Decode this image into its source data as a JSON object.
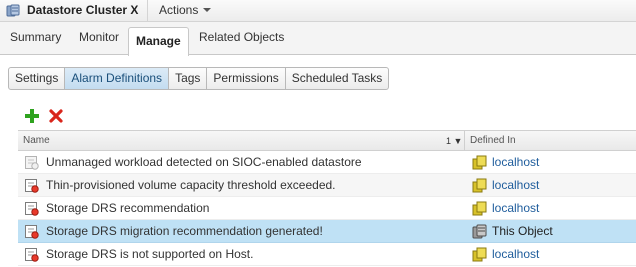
{
  "header": {
    "title": "Datastore Cluster X",
    "actions_label": "Actions"
  },
  "main_tabs": [
    {
      "label": "Summary"
    },
    {
      "label": "Monitor"
    },
    {
      "label": "Manage",
      "active": true
    },
    {
      "label": "Related Objects"
    }
  ],
  "sub_tabs": [
    {
      "label": "Settings"
    },
    {
      "label": "Alarm Definitions",
      "active": true
    },
    {
      "label": "Tags"
    },
    {
      "label": "Permissions"
    },
    {
      "label": "Scheduled Tasks"
    }
  ],
  "toolbar": {
    "add_icon": "plus-icon",
    "delete_icon": "x-icon",
    "add_color": "#2fa31f",
    "delete_color": "#d9261c"
  },
  "table": {
    "columns": {
      "name": "Name",
      "sort_indicator": "1 ▼",
      "defined_in": "Defined In"
    },
    "rows": [
      {
        "name": "Unmanaged workload detected on SIOC-enabled datastore",
        "defined_in": "localhost",
        "alarm_enabled": false,
        "selected": false
      },
      {
        "name": "Thin-provisioned volume capacity threshold exceeded.",
        "defined_in": "localhost",
        "alarm_enabled": true,
        "selected": false
      },
      {
        "name": "Storage DRS recommendation",
        "defined_in": "localhost",
        "alarm_enabled": true,
        "selected": false
      },
      {
        "name": "Storage DRS migration recommendation generated!",
        "defined_in": "This Object",
        "alarm_enabled": true,
        "selected": true
      },
      {
        "name": "Storage DRS is not supported on Host.",
        "defined_in": "localhost",
        "alarm_enabled": true,
        "selected": false
      }
    ]
  },
  "colors": {
    "selected_row": "#bfe1f5",
    "link": "#1f5d9c",
    "host_icon": "#c9b51a"
  }
}
